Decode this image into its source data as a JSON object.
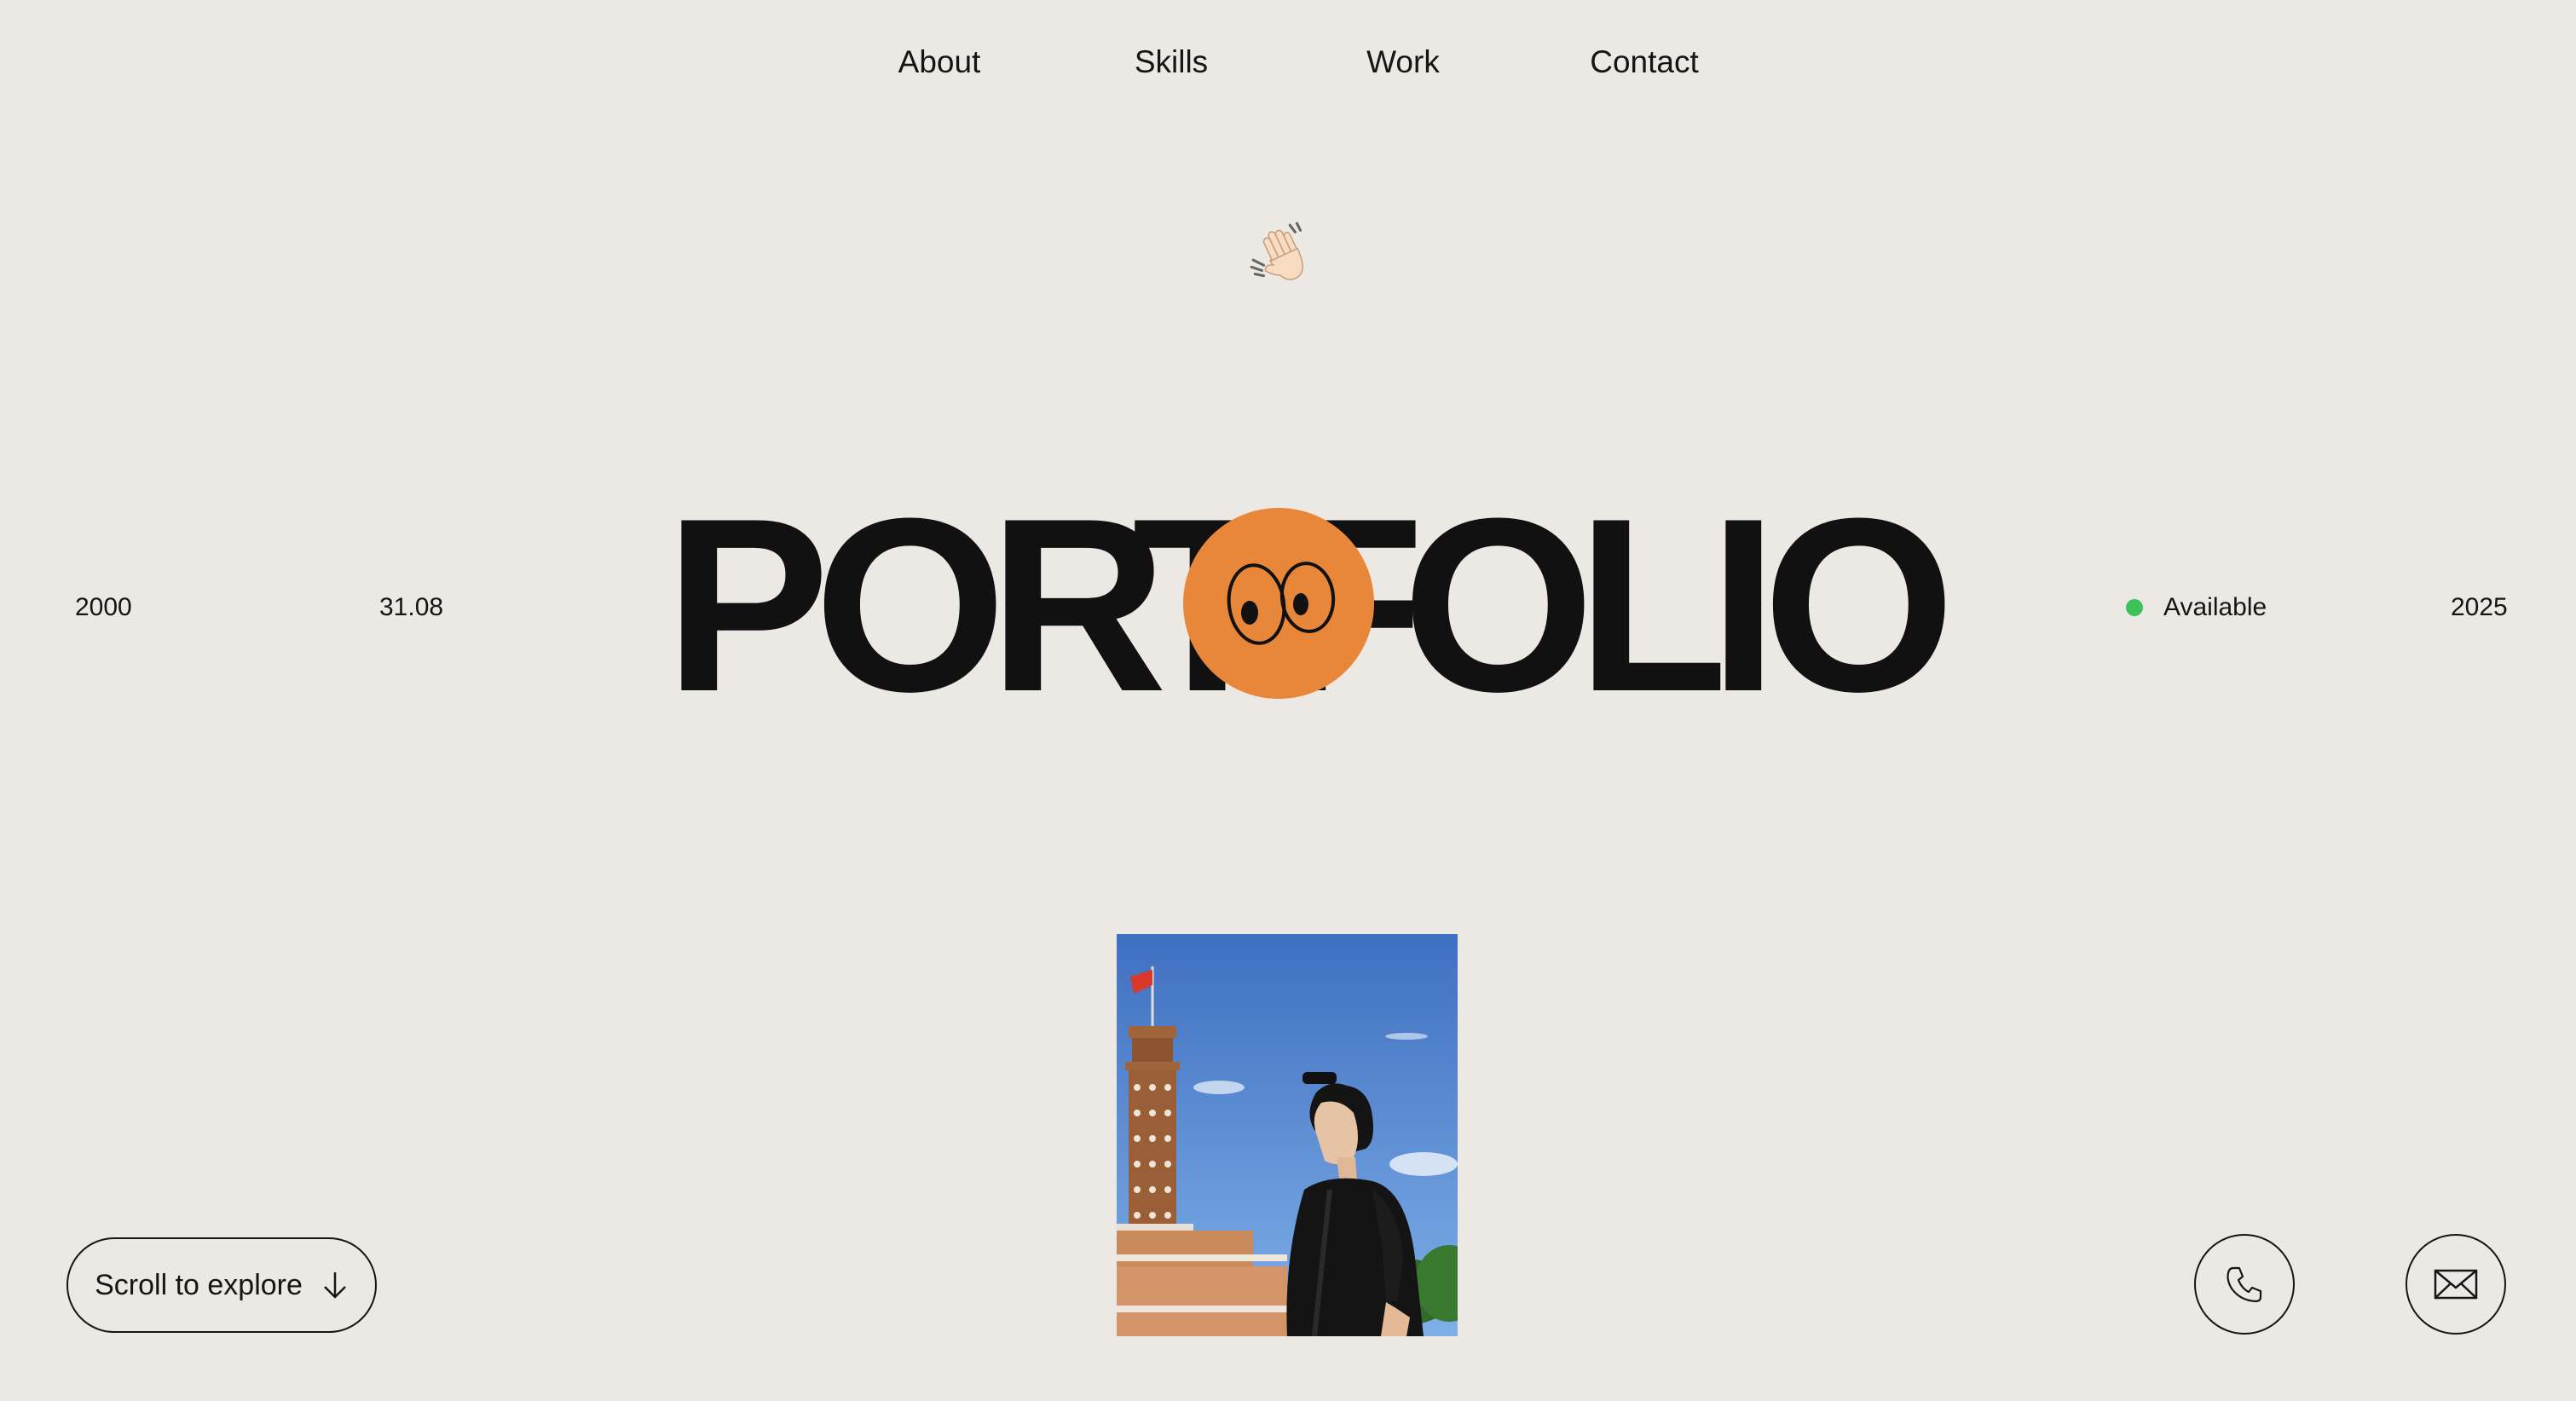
{
  "nav": {
    "items": [
      {
        "label": "About"
      },
      {
        "label": "Skills"
      },
      {
        "label": "Work"
      },
      {
        "label": "Contact"
      }
    ]
  },
  "hero": {
    "wave_icon": "waving-hand-icon",
    "left_year": "2000",
    "left_date": "31.08",
    "title_letters": [
      "P",
      "O",
      "R",
      "T",
      "F",
      "O",
      "L",
      "I",
      "O"
    ],
    "title_icon": "googly-eyes-icon",
    "status": {
      "label": "Available",
      "color": "#3ec25a"
    },
    "right_year": "2025",
    "accent_color": "#e8873a"
  },
  "photo": {
    "subject": "portrait-photo"
  },
  "footer": {
    "scroll_label": "Scroll to explore",
    "scroll_icon": "arrow-down-icon",
    "phone_icon": "phone-icon",
    "mail_icon": "mail-icon"
  }
}
